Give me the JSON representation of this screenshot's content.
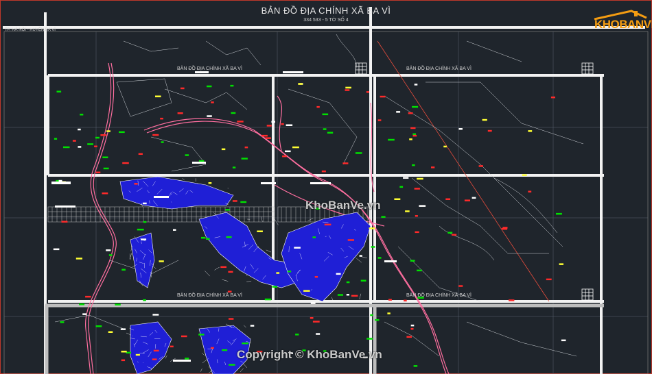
{
  "map": {
    "title": "BẢN ĐỒ ĐỊA CHÍNH XÃ BA VÌ",
    "subtitle": "334 533 - 5 TỜ SỐ 4",
    "location": "TP. HÀ NỘI - HUYỆN BA VÌ",
    "sheet_labels": [
      "BẢN ĐỒ ĐỊA CHÍNH XÃ BA VÌ",
      "BẢN ĐỒ ĐỊA CHÍNH XÃ BA VÌ",
      "BẢN ĐỒ ĐỊA CHÍNH XÃ BA VÌ",
      "BẢN ĐỒ ĐỊA CHÍNH XÃ BA VÌ"
    ]
  },
  "watermark": {
    "center": "KhoBanVe.vn",
    "copyright": "Copyright © KhoBanVe.vn"
  },
  "logo": {
    "text": "KHOBANVE",
    "icon": "house-roof-icon"
  },
  "colors": {
    "background": "#1f252c",
    "parcel_fill": "#1f1fd6",
    "road": "#ff6fa0",
    "frame": "#f2f2f2",
    "accent": "#f39c12"
  }
}
